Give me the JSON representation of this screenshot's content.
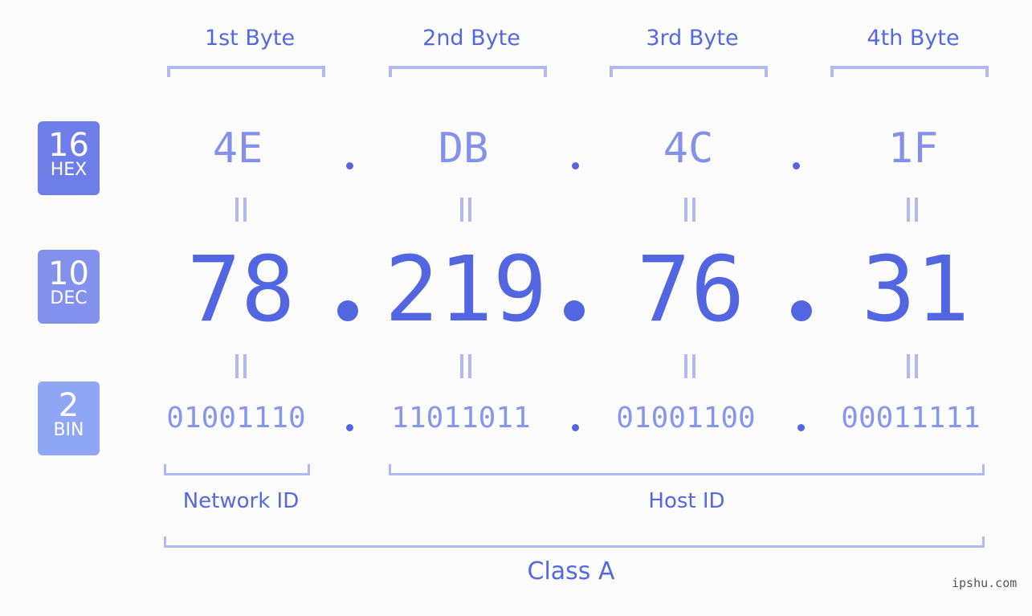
{
  "byte_labels": [
    "1st Byte",
    "2nd Byte",
    "3rd Byte",
    "4th Byte"
  ],
  "badges": {
    "hex": {
      "number": "16",
      "label": "HEX",
      "color": "#6d7ee9"
    },
    "dec": {
      "number": "10",
      "label": "DEC",
      "color": "#8291ee"
    },
    "bin": {
      "number": "2",
      "label": "BIN",
      "color": "#8ea6f5"
    }
  },
  "hex_values": [
    "4E",
    "DB",
    "4C",
    "1F"
  ],
  "dec_values": [
    "78",
    "219",
    "76",
    "31"
  ],
  "bin_values": [
    "01001110",
    "11011011",
    "01001100",
    "00011111"
  ],
  "network_id_label": "Network ID",
  "host_id_label": "Host ID",
  "class_label": "Class A",
  "watermark": "ipshu.com"
}
